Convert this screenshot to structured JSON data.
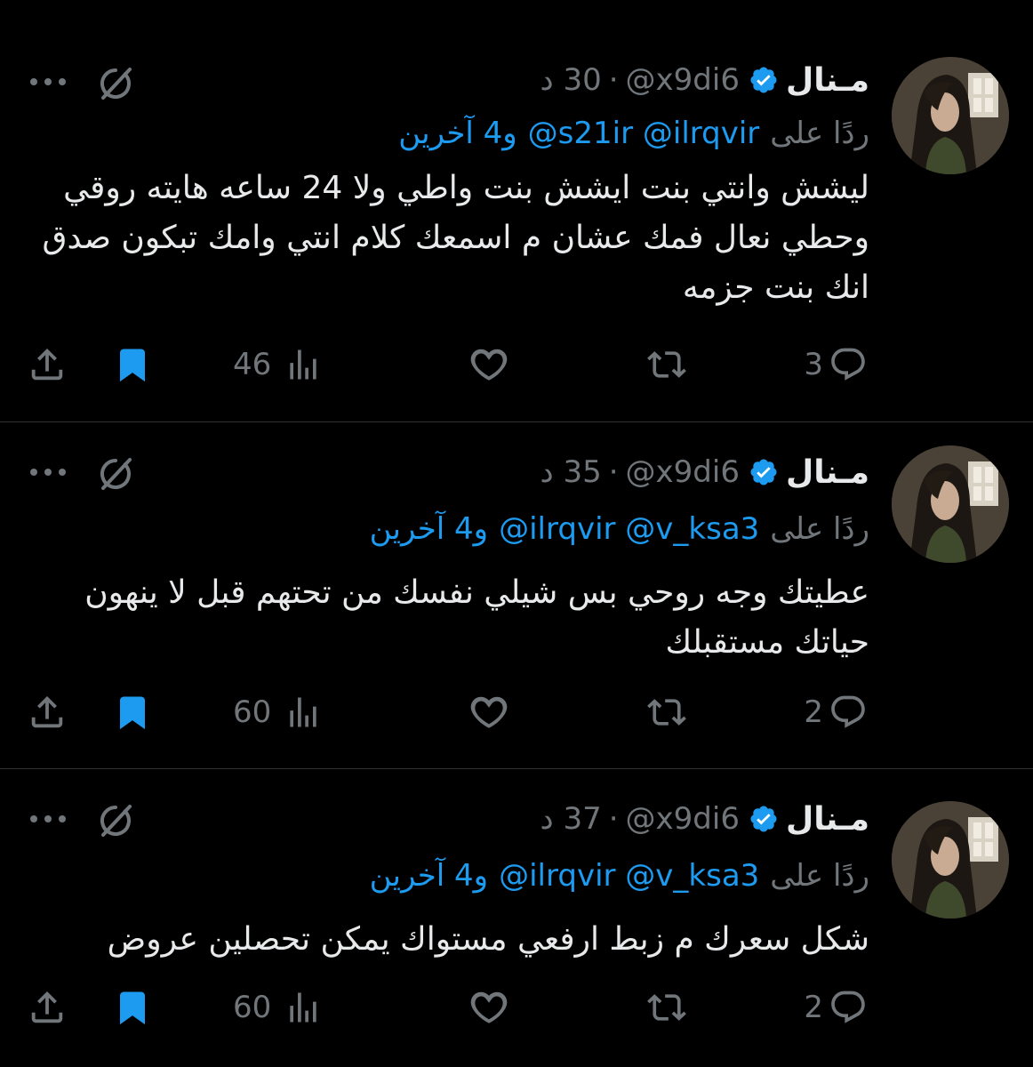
{
  "colors": {
    "background": "#000000",
    "text": "#e7e9ea",
    "muted": "#71767b",
    "accent": "#1d9bf0",
    "divider": "#2f3336"
  },
  "icons": [
    "verified-badge-icon",
    "grok-icon",
    "more-icon",
    "reply-icon",
    "retweet-icon",
    "like-icon",
    "views-icon",
    "bookmark-icon",
    "share-icon"
  ],
  "tweets": [
    {
      "name": "مـنال",
      "handle": "@x9di6",
      "separator": "·",
      "time": "30 د",
      "reply_label": "ردًا على",
      "mentions": "@s21ir @ilrqvir",
      "others": "و4 آخرين",
      "text": "ليشش وانتي بنت ايشش بنت واطي ولا 24 ساعه هايته روقي وحطي نعال فمك عشان م اسمعك كلام انتي وامك تبكون صدق انك بنت جزمه",
      "replies": "3",
      "views": "46"
    },
    {
      "name": "مـنال",
      "handle": "@x9di6",
      "separator": "·",
      "time": "35 د",
      "reply_label": "ردًا على",
      "mentions": "@ilrqvir @v_ksa3",
      "others": "و4 آخرين",
      "text": "عطيتك وجه روحي بس شيلي نفسك من تحتهم قبل لا ينهون حياتك مستقبلك",
      "replies": "2",
      "views": "60"
    },
    {
      "name": "مـنال",
      "handle": "@x9di6",
      "separator": "·",
      "time": "37 د",
      "reply_label": "ردًا على",
      "mentions": "@ilrqvir @v_ksa3",
      "others": "و4 آخرين",
      "text": "شكل سعرك م زبط ارفعي مستواك يمكن تحصلين عروض",
      "replies": "2",
      "views": "60"
    }
  ]
}
